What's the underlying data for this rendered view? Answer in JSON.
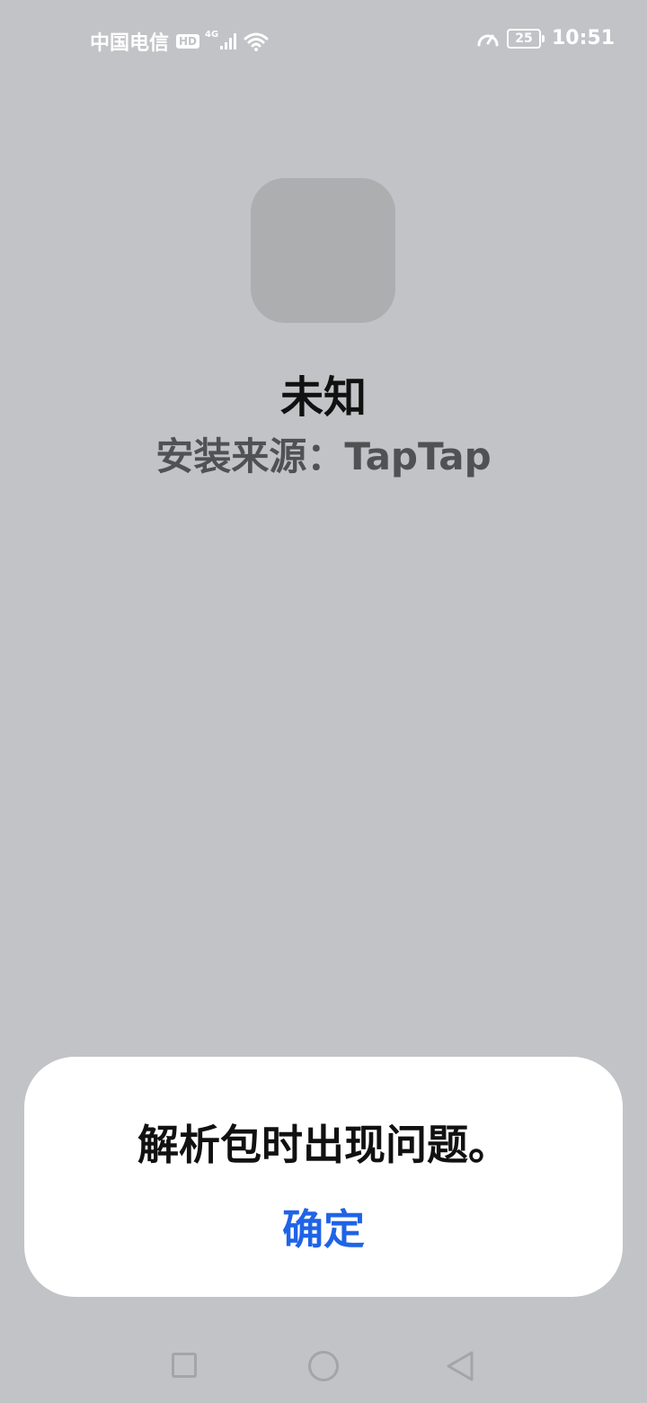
{
  "status_bar": {
    "carrier": "中国电信",
    "hd_badge": "HD",
    "network_type": "4G",
    "battery_level": "25",
    "time": "10:51"
  },
  "app": {
    "name": "未知",
    "source": "安装来源：TapTap"
  },
  "dialog": {
    "message": "解析包时出现问题。",
    "confirm_label": "确定",
    "accent_color": "#1f64e6"
  },
  "nav": {
    "recent": "square-icon",
    "home": "circle-icon",
    "back": "triangle-back-icon"
  }
}
